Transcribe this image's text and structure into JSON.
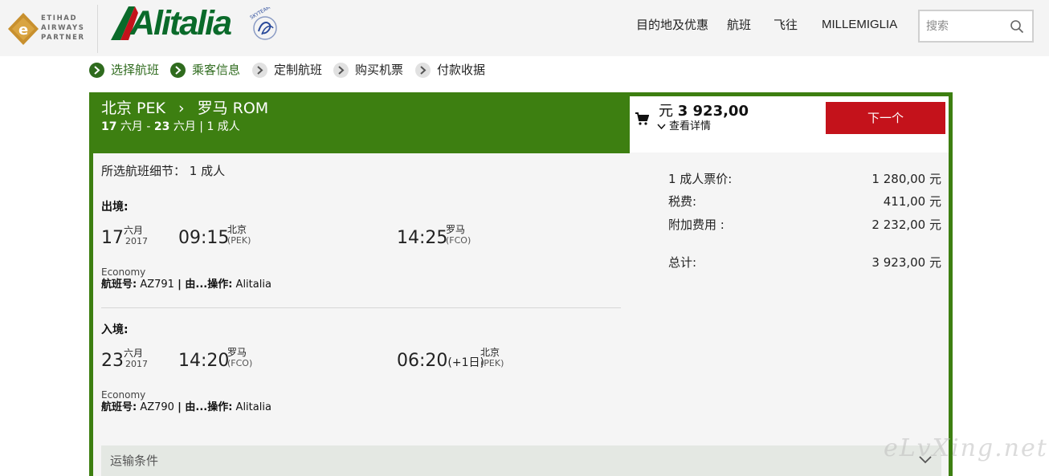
{
  "header": {
    "etihad_logo_text": [
      "ETIHAD",
      "AIRWAYS",
      "PARTNER"
    ],
    "alitalia_logo_text": "Alitalia",
    "skyteam_logo_text": "SKYTEAM",
    "nav": [
      "目的地及优惠",
      "航班",
      "飞往",
      "MILLEMIGLIA"
    ],
    "search_placeholder": "搜索",
    "colors": {
      "brand_green": "#0a6a2a",
      "header_bg": "#f4f4f4"
    }
  },
  "steps": [
    {
      "label": "选择航班",
      "state": "done"
    },
    {
      "label": "乘客信息",
      "state": "done"
    },
    {
      "label": "定制航班",
      "state": "pending"
    },
    {
      "label": "购买机票",
      "state": "pending"
    },
    {
      "label": "付款收据",
      "state": "pending"
    }
  ],
  "trip": {
    "from": "北京 PEK",
    "to": "罗马 ROM",
    "date_out": "17",
    "date_out_month": "六月",
    "date_sep": " - ",
    "date_in": "23",
    "date_in_month": "六月",
    "pax": "| 1 成人"
  },
  "summary": {
    "currency": "元",
    "total_price": "3 923,00",
    "details_label": "查看详情",
    "next_button": "下一个",
    "fares": [
      {
        "label": "1 成人票价:",
        "value": "1 280,00 元"
      },
      {
        "label": "税费:",
        "value": "411,00 元"
      },
      {
        "label": "附加费用 :",
        "value": "2 232,00 元"
      }
    ],
    "total_label": "总计:",
    "total_value": "3 923,00 元",
    "colors": {
      "panel_green": "#3d7f11",
      "next_red": "#c4121b"
    }
  },
  "flight_details": {
    "title": "所选航班细节： 1 成人",
    "outbound": {
      "title": "出境:",
      "day": "17",
      "month": "六月",
      "year": "2017",
      "dep_time": "09:15",
      "dep_city": "北京",
      "dep_code": "(PEK)",
      "arr_time": "14:25",
      "arr_plus": "",
      "arr_city": "罗马",
      "arr_code": "(FCO)",
      "cabin": "Economy",
      "flight_label": "航班号:",
      "flight_no": "AZ791",
      "op_label": "| 由...操作:",
      "carrier": "Alitalia"
    },
    "inbound": {
      "title": "入境:",
      "day": "23",
      "month": "六月",
      "year": "2017",
      "dep_time": "14:20",
      "dep_city": "罗马",
      "dep_code": "(FCO)",
      "arr_time": "06:20",
      "arr_plus": "(+1日)",
      "arr_city": "北京",
      "arr_code": "(PEK)",
      "cabin": "Economy",
      "flight_label": "航班号:",
      "flight_no": "AZ790",
      "op_label": "| 由...操作:",
      "carrier": "Alitalia"
    },
    "conditions_label": "运输条件"
  },
  "watermark": "eLvXing.net"
}
